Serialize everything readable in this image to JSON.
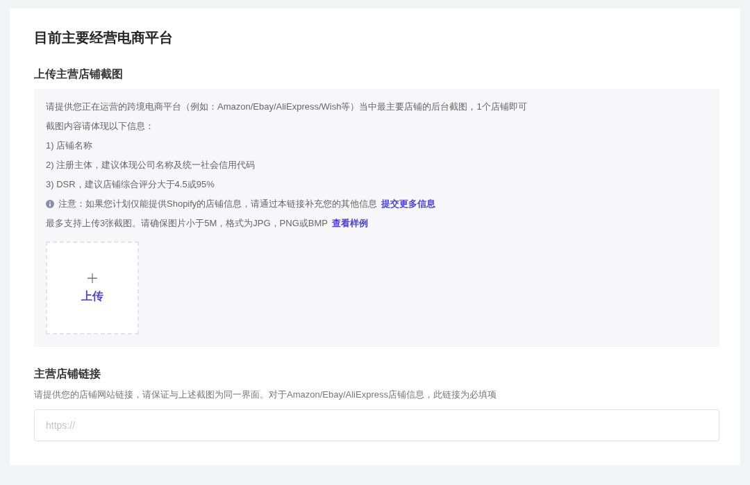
{
  "title": "目前主要经营电商平台",
  "screenshot_section": {
    "heading": "上传主营店铺截图",
    "lines": [
      "请提供您正在运营的跨境电商平台（例如：Amazon/Ebay/AliExpress/Wish等）当中最主要店铺的后台截图，1个店铺即可",
      "截图内容请体现以下信息：",
      "1) 店铺名称",
      "2) 注册主体，建议体现公司名称及统一社会信用代码",
      "3) DSR，建议店铺综合评分大于4.5或95%"
    ],
    "notice": {
      "text": "注意：如果您计划仅能提供Shopify的店铺信息，请通过本链接补充您的其他信息",
      "link": "提交更多信息"
    },
    "limit": {
      "text": "最多支持上传3张截图。请确保图片小于5M，格式为JPG，PNG或BMP",
      "link": "查看样例"
    },
    "upload": {
      "label": "上传"
    }
  },
  "link_section": {
    "heading": "主营店铺链接",
    "description": "请提供您的店铺网站链接，请保证与上述截图为同一界面。对于Amazon/Ebay/AliExpress店铺信息，此链接为必填项",
    "input": {
      "placeholder": "https://"
    }
  }
}
